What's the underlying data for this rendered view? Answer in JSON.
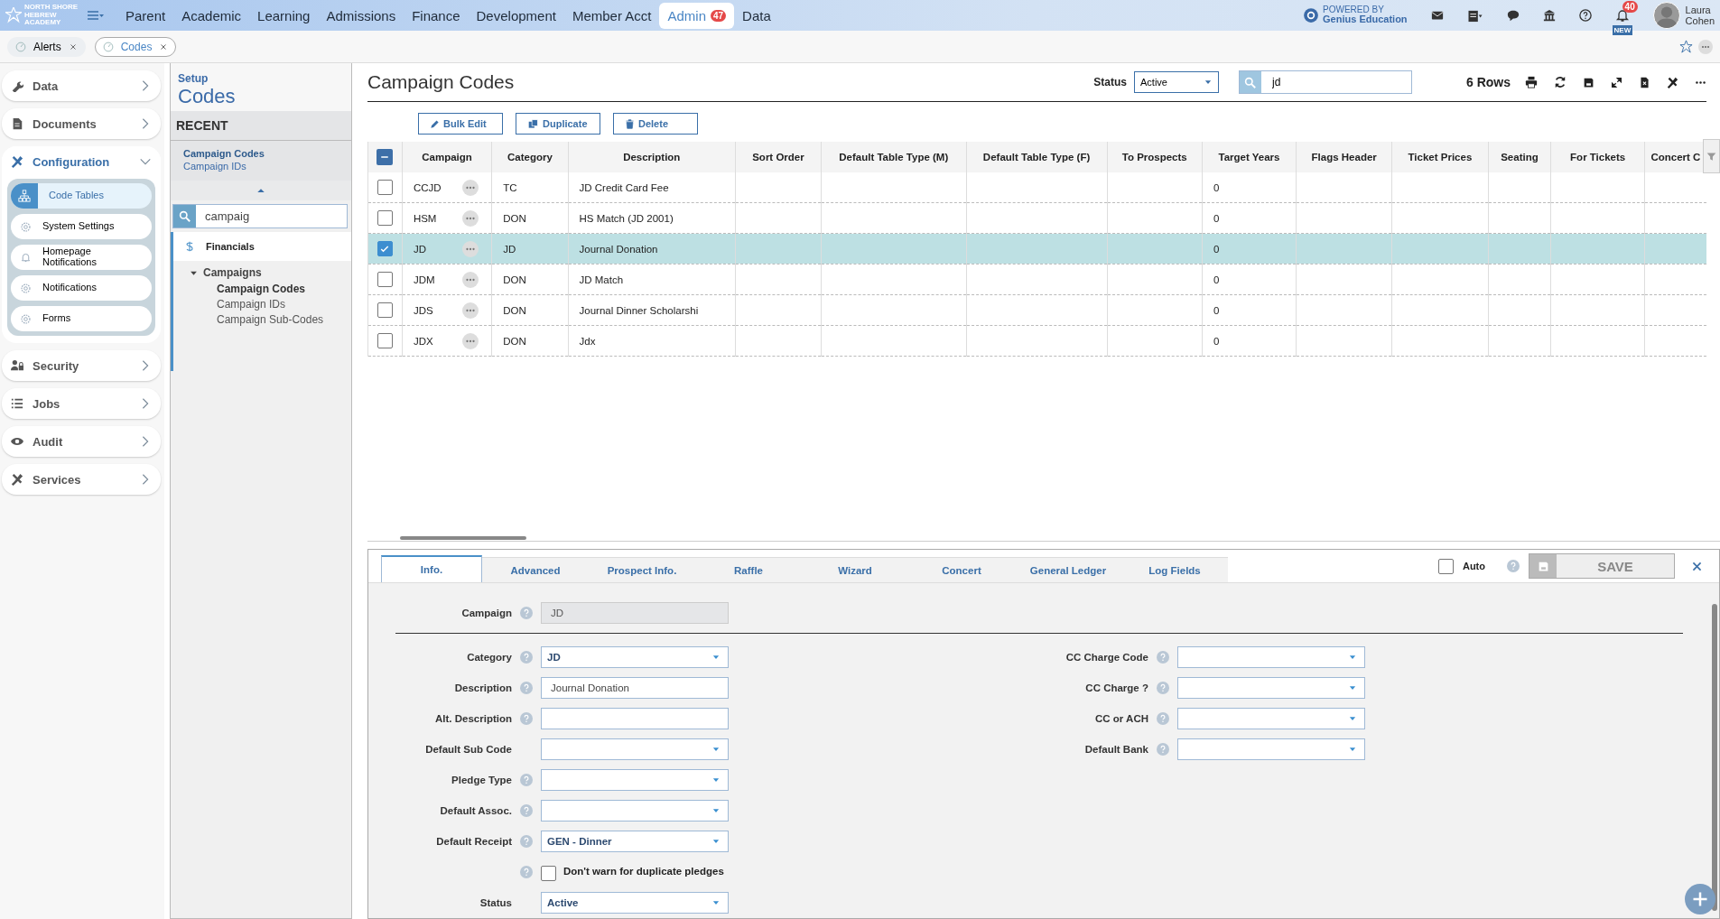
{
  "logo": {
    "text": "NORTH SHORE HEBREW ACADEMY"
  },
  "top_nav": [
    {
      "label": "Parent",
      "selected": false
    },
    {
      "label": "Academic",
      "selected": false
    },
    {
      "label": "Learning",
      "selected": false
    },
    {
      "label": "Admissions",
      "selected": false
    },
    {
      "label": "Finance",
      "selected": false
    },
    {
      "label": "Development",
      "selected": false
    },
    {
      "label": "Member Acct",
      "selected": false
    },
    {
      "label": "Admin",
      "selected": true,
      "badge": "47"
    },
    {
      "label": "Data",
      "selected": false
    }
  ],
  "powered_by": {
    "line1": "POWERED BY",
    "line2": "Genius Education"
  },
  "notifications": {
    "count": "40",
    "tag": "NEW"
  },
  "user": {
    "first": "Laura",
    "last": "Cohen"
  },
  "open_tabs": [
    {
      "label": "Alerts",
      "selected": false
    },
    {
      "label": "Codes",
      "selected": true
    }
  ],
  "sidebar": {
    "items": [
      {
        "label": "Data",
        "expanded": false
      },
      {
        "label": "Documents",
        "expanded": false
      },
      {
        "label": "Configuration",
        "expanded": true,
        "children": [
          {
            "label": "Code Tables",
            "selected": true
          },
          {
            "label": "System Settings",
            "selected": false
          },
          {
            "label": "Homepage Notifications",
            "selected": false
          },
          {
            "label": "Notifications",
            "selected": false
          },
          {
            "label": "Forms",
            "selected": false
          }
        ]
      },
      {
        "label": "Security",
        "expanded": false
      },
      {
        "label": "Jobs",
        "expanded": false
      },
      {
        "label": "Audit",
        "expanded": false
      },
      {
        "label": "Services",
        "expanded": false
      }
    ]
  },
  "nav_panel": {
    "subtitle": "Setup",
    "title": "Codes",
    "recent_heading": "RECENT",
    "recent": [
      {
        "label": "Campaign Codes",
        "selected": true
      },
      {
        "label": "Campaign IDs",
        "selected": false
      }
    ],
    "search": "campaig",
    "group": "Financials",
    "tree": [
      {
        "label": "Campaigns",
        "expanded": true,
        "children": [
          {
            "label": "Campaign Codes",
            "selected": true
          },
          {
            "label": "Campaign IDs",
            "selected": false
          },
          {
            "label": "Campaign Sub-Codes",
            "selected": false
          }
        ]
      }
    ]
  },
  "page": {
    "title": "Campaign Codes",
    "status_label": "Status",
    "status": "Active",
    "search": "jd",
    "row_count": "6 Rows"
  },
  "actions": [
    "Bulk Edit",
    "Duplicate",
    "Delete"
  ],
  "table": {
    "select_all_partial": true,
    "columns": [
      "Campaign",
      "Category",
      "Description",
      "Sort Order",
      "Default Table Type (M)",
      "Default Table Type (F)",
      "To Prospects",
      "Target Years",
      "Flags Header",
      "Ticket Prices",
      "Seating",
      "For Tickets",
      "Concert C"
    ],
    "rows": [
      {
        "campaign": "CCJD",
        "category": "TC",
        "description": "JD Credit Card Fee",
        "target_years": "0",
        "selected": false
      },
      {
        "campaign": "HSM",
        "category": "DON",
        "description": "HS Match (JD 2001)",
        "target_years": "0",
        "selected": false
      },
      {
        "campaign": "JD",
        "category": "JD",
        "description": "Journal Donation",
        "target_years": "0",
        "selected": true
      },
      {
        "campaign": "JDM",
        "category": "DON",
        "description": "JD Match",
        "target_years": "0",
        "selected": false
      },
      {
        "campaign": "JDS",
        "category": "DON",
        "description": "Journal Dinner Scholarshi",
        "target_years": "0",
        "selected": false
      },
      {
        "campaign": "JDX",
        "category": "DON",
        "description": "Jdx",
        "target_years": "0",
        "selected": false
      }
    ]
  },
  "form": {
    "tabs": [
      {
        "label": "Info.",
        "selected": true
      },
      {
        "label": "Advanced",
        "selected": false
      },
      {
        "label": "Prospect Info.",
        "selected": false
      },
      {
        "label": "Raffle",
        "selected": false
      },
      {
        "label": "Wizard",
        "selected": false
      },
      {
        "label": "Concert",
        "selected": false
      },
      {
        "label": "General Ledger",
        "selected": false
      },
      {
        "label": "Log Fields",
        "selected": false
      }
    ],
    "auto": {
      "label": "Auto",
      "checked": false
    },
    "save": "SAVE",
    "key_field": {
      "label": "Campaign",
      "kind": "readonly",
      "value": "JD",
      "help": true
    },
    "left": [
      {
        "label": "Category",
        "kind": "select",
        "value": "JD",
        "help": true
      },
      {
        "label": "Description",
        "kind": "text",
        "value": "Journal Donation",
        "help": true
      },
      {
        "label": "Alt. Description",
        "kind": "text",
        "help": true
      },
      {
        "label": "Default Sub Code",
        "kind": "select",
        "help": false
      },
      {
        "label": "Pledge Type",
        "kind": "select",
        "help": true
      },
      {
        "label": "Default Assoc.",
        "kind": "select",
        "help": true
      },
      {
        "label": "Default Receipt",
        "kind": "select",
        "value": "GEN - Dinner",
        "help": true
      },
      {
        "label": "Don't warn for duplicate pledges",
        "kind": "checkbox",
        "checked": false,
        "help": true
      },
      {
        "label": "Status",
        "kind": "select",
        "value": "Active",
        "help": false
      }
    ],
    "right": [
      {
        "label": "CC Charge Code",
        "kind": "select",
        "help": true
      },
      {
        "label": "CC Charge ?",
        "kind": "select",
        "help": true
      },
      {
        "label": "CC or ACH",
        "kind": "select",
        "help": true
      },
      {
        "label": "Default Bank",
        "kind": "select",
        "help": true
      }
    ]
  }
}
